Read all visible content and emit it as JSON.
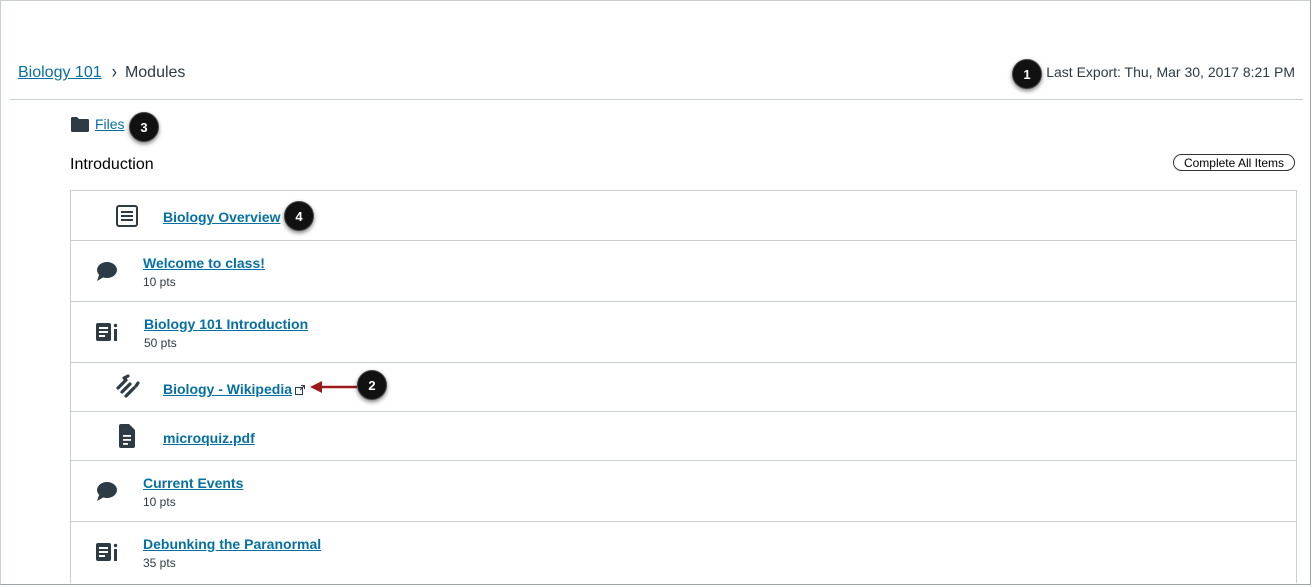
{
  "breadcrumb": {
    "course": "Biology 101",
    "separator": "›",
    "current": "Modules"
  },
  "last_export": "Last Export: Thu, Mar 30, 2017 8:21 PM",
  "files_link": "Files",
  "module": {
    "title": "Introduction",
    "complete_button": "Complete All Items",
    "items": [
      {
        "title": "Biology Overview",
        "pts": "",
        "icon": "page-icon"
      },
      {
        "title": "Welcome to class!",
        "pts": "10 pts",
        "icon": "discussion-icon"
      },
      {
        "title": "Biology 101 Introduction",
        "pts": "50 pts",
        "icon": "assignment-icon"
      },
      {
        "title": "Biology - Wikipedia",
        "pts": "",
        "icon": "link-icon"
      },
      {
        "title": "microquiz.pdf",
        "pts": "",
        "icon": "document-icon"
      },
      {
        "title": "Current Events",
        "pts": "10 pts",
        "icon": "discussion-icon"
      },
      {
        "title": "Debunking the Paranormal",
        "pts": "35 pts",
        "icon": "assignment-icon"
      }
    ]
  },
  "callouts": [
    "1",
    "2",
    "3",
    "4"
  ],
  "colors": {
    "link": "#0770a3",
    "text": "#2d3b45",
    "border": "#c7cdd1",
    "callout": "#111111",
    "arrow": "#9b1b1b"
  }
}
